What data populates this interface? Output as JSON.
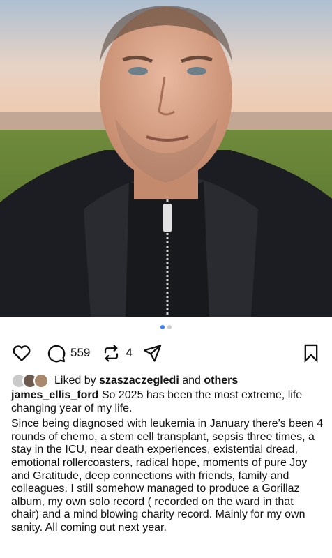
{
  "post": {
    "username": "james_ellis_ford",
    "comments_count": "559",
    "reposts_count": "4",
    "liked_by_prefix": "Liked by",
    "liked_by_user": "szaszaczegledi",
    "liked_by_and": "and",
    "liked_by_others": "others",
    "caption_intro": "So 2025 has been the most extreme, life changing year of my life.",
    "caption_body": "Since being diagnosed with leukemia in January there’s been 4 rounds of chemo, a stem cell transplant, sepsis three times, a stay in the ICU, near death experiences, existential dread, emotional rollercoasters, radical hope, moments of pure Joy and Gratitude, deep connections with friends, family and colleagues. I still somehow managed to produce a Gorillaz album, my own solo record ( recorded on the ward in that chair) and a mind blowing charity record. Mainly for my own sanity. All coming out next year.",
    "carousel": {
      "total": 2,
      "current": 1
    }
  },
  "icons": [
    "heart-icon",
    "comment-icon",
    "repost-icon",
    "share-icon",
    "bookmark-icon"
  ],
  "colors": {
    "accent": "#3b82f6",
    "text": "#111111"
  }
}
